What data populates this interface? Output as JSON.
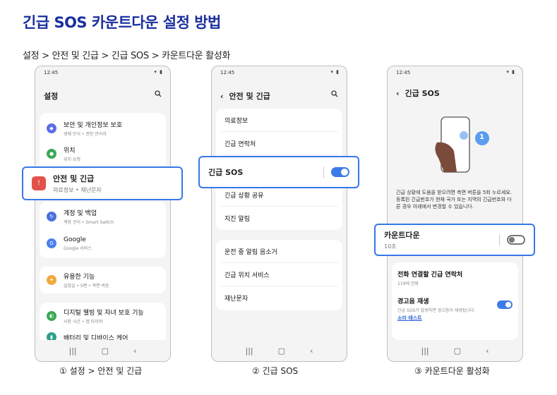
{
  "title": "긴급 SOS 카운트다운 설정 방법",
  "breadcrumb": "설정 > 안전 및 긴급 > 긴급 SOS > 카운트다운 활성화",
  "status_time": "12:45",
  "phone1": {
    "header": "설정",
    "items": [
      {
        "title": "보안 및 개인정보 보호",
        "sub": "생체 인식 • 권한 관리자",
        "color": "#5b6ee8",
        "icon": "shield-icon"
      },
      {
        "title": "위치",
        "sub": "위치 요청",
        "color": "#3aa856",
        "icon": "location-icon"
      },
      {
        "title": "안전 및 긴급",
        "sub": "의료정보 • 재난문자",
        "color": "#e2524b",
        "icon": "emergency-icon"
      },
      {
        "title": "계정 및 백업",
        "sub": "계정 관리 • Smart Switch",
        "color": "#4b6fe0",
        "icon": "sync-icon"
      },
      {
        "title": "Google",
        "sub": "Google 서비스",
        "color": "#4b7ff0",
        "icon": "google-icon"
      },
      {
        "title": "유용한 기능",
        "sub": "실험실 • S펜 • 측면 버튼",
        "color": "#f2a93b",
        "icon": "star-icon"
      },
      {
        "title": "디지털 웰빙 및 자녀 보호 기능",
        "sub": "사용 시간 • 앱 타이머",
        "color": "#3aa856",
        "icon": "wellbeing-icon"
      },
      {
        "title": "배터리 및 디바이스 케어",
        "sub": "",
        "color": "#2e9e8a",
        "icon": "battery-icon"
      }
    ],
    "caption": "① 설정 > 안전 및 긴급"
  },
  "phone2": {
    "header": "안전 및 긴급",
    "group1": [
      "의료정보",
      "긴급 연락처"
    ],
    "sos": "긴급 SOS",
    "group1b": [
      "긴급 상황 공유",
      "지진 알림"
    ],
    "group2": [
      "운전 중 알림 음소거",
      "긴급 위치 서비스",
      "재난문자"
    ],
    "caption": "② 긴급 SOS"
  },
  "phone3": {
    "header": "긴급 SOS",
    "step_number": "1",
    "description": "긴급 상황에 도움을 받으려면 측면 버튼을 5회 누르세요. 등록된 긴급번호가 현재 국가 또는 지역의 긴급번호와 다른 경우 아래에서 변경할 수 있습니다.",
    "countdown_title": "카운트다운",
    "countdown_sub": "10초",
    "call_title": "전화 연결할 긴급 연락처",
    "call_sub": "119에 전화",
    "alarm_title": "경고음 재생",
    "alarm_sub": "긴급 SOS가 발생하면 경고음이 재생됩니다.",
    "alarm_link": "소리 테스트",
    "caption": "③ 카운트다운 활성화"
  },
  "nav_icons": [
    "recents-icon",
    "home-icon",
    "back-icon"
  ],
  "colors": {
    "accent": "#3777e8",
    "title": "#1a2f9e"
  }
}
